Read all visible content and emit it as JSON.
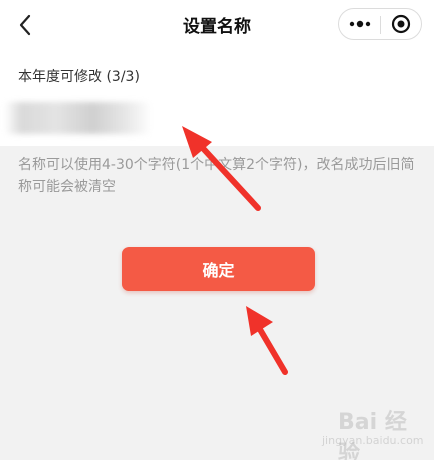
{
  "navbar": {
    "title": "设置名称",
    "back_icon": "chevron-left-icon",
    "more_icon": "more-dots-icon",
    "close_icon": "target-close-icon"
  },
  "form": {
    "quota_label": "本年度可修改 (3/3)",
    "name_value": "",
    "hint": "名称可以使用4-30个字符(1个中文算2个字符)，改名成功后旧简称可能会被清空"
  },
  "actions": {
    "confirm_label": "确定"
  },
  "watermark": {
    "text": "Bai 经验",
    "sub": "jingyan.baidu.com"
  },
  "colors": {
    "primary": "#f45a45",
    "arrow": "#f0322a",
    "background": "#f2f2f2"
  }
}
